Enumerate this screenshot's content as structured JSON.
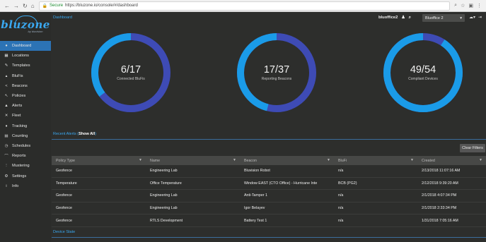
{
  "browser": {
    "secure_label": "Secure",
    "url": "https://bluzone.io/console/#/dashboard"
  },
  "logo": {
    "word": "bluzone",
    "sub": "by bluvision"
  },
  "sidebar": {
    "items": [
      {
        "label": "Dashboard",
        "icon": "dashboard-icon",
        "glyph": "●"
      },
      {
        "label": "Locations",
        "icon": "locations-icon",
        "glyph": "▦"
      },
      {
        "label": "Templates",
        "icon": "templates-icon",
        "glyph": "✎"
      },
      {
        "label": "BluFis",
        "icon": "blufi-icon",
        "glyph": "▴"
      },
      {
        "label": "Beacons",
        "icon": "beacons-icon",
        "glyph": "<"
      },
      {
        "label": "Policies",
        "icon": "policies-icon",
        "glyph": "↖"
      },
      {
        "label": "Alerts",
        "icon": "alerts-icon",
        "glyph": "▲"
      },
      {
        "label": "Fleet",
        "icon": "fleet-icon",
        "glyph": "✕"
      },
      {
        "label": "Tracking",
        "icon": "tracking-icon",
        "glyph": "♦"
      },
      {
        "label": "Counting",
        "icon": "counting-icon",
        "glyph": "▤"
      },
      {
        "label": "Schedules",
        "icon": "schedules-icon",
        "glyph": "◷"
      },
      {
        "label": "Reports",
        "icon": "reports-icon",
        "glyph": "⌒"
      },
      {
        "label": "Mustering",
        "icon": "mustering-icon",
        "glyph": "⋮"
      },
      {
        "label": "Settings",
        "icon": "settings-icon",
        "glyph": "⚙"
      },
      {
        "label": "Info",
        "icon": "info-icon",
        "glyph": "i"
      }
    ]
  },
  "header": {
    "breadcrumb": "Dashboard",
    "user": "bluoffice2",
    "account_select": "Bluoffice 2"
  },
  "donuts": [
    {
      "value": "6/17",
      "label": "Connected BluFis",
      "fraction": 0.353
    },
    {
      "value": "17/37",
      "label": "Reporting Beacons",
      "fraction": 0.459
    },
    {
      "value": "49/54",
      "label": "Compliant Devices",
      "fraction": 0.907
    }
  ],
  "colors": {
    "accent": "#3aa8f0",
    "donut_fill": "#1a9be8",
    "donut_rest": "#3e4bb5",
    "active_nav": "#2c73b5"
  },
  "alerts": {
    "title": "Recent Alerts",
    "show_all": "Show All",
    "clear_filters": "Clear Filters",
    "columns": [
      "Policy Type",
      "Name",
      "Beacon",
      "BluFi",
      "Created"
    ],
    "rows": [
      [
        "Geofence",
        "Engineering Lab",
        "Bluvision Robot",
        "n/a",
        "2/13/2018 11:07:16 AM"
      ],
      [
        "Temperature",
        "Office Temperature",
        "Window EAST (CTO Office) - Hurricane Inte",
        "BCB (PG2)",
        "2/12/2018 9:39:20 AM"
      ],
      [
        "Geofence",
        "Engineering Lab",
        "Anti-Tamper 1",
        "n/a",
        "2/1/2018 4:07:34 PM"
      ],
      [
        "Geofence",
        "Engineering Lab",
        "Igor Belayev",
        "n/a",
        "2/1/2018 2:33:34 PM"
      ],
      [
        "Geofence",
        "RTLS Development",
        "Battery Test 1",
        "n/a",
        "1/31/2018 7:05:16 AM"
      ]
    ]
  },
  "device_state": "Device State"
}
